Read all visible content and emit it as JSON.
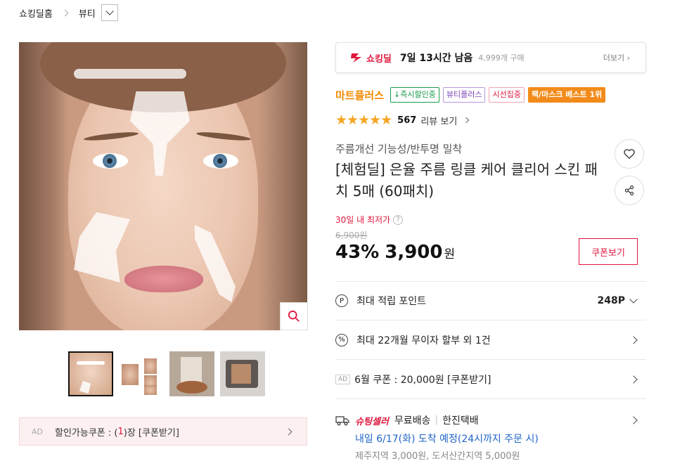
{
  "breadcrumb": {
    "home": "쇼킹딜홈",
    "category": "뷰티"
  },
  "coupon_bar": {
    "ad": "AD",
    "prefix": "할인가능쿠폰 : (",
    "count": "1",
    "suffix": ")장 [쿠폰받기]"
  },
  "deal": {
    "logo": "쇼킹딜",
    "time_left": "7일 13시간 남음",
    "sold": "4,999개 구매",
    "more": "더보기"
  },
  "brand": "마트플러스",
  "badges": [
    "↓즉시할인중",
    "뷰티플러스",
    "시선집중",
    "팩/마스크 베스트 1위"
  ],
  "rating": {
    "stars": "★★★★★",
    "count": "567",
    "review_label": "리뷰 보기"
  },
  "product": {
    "subtitle": "주름개선 기능성/반투명 밀착",
    "title": "[체험딜] 은율 주름 링클 케어 클리어 스킨 패치 5매 (60패치)"
  },
  "pricing": {
    "lowest_label": "30일 내 최저가",
    "help": "?",
    "original": "6,900원",
    "discount": "43%",
    "price": "3,900",
    "won": "원",
    "coupon_button": "쿠폰보기"
  },
  "rows": {
    "points_icon": "P",
    "points_label": "최대 적립 포인트",
    "points_value": "248P",
    "installment_icon": "%",
    "installment_label": "최대 22개월 무이자 할부 외 1건",
    "coupon_ad": "AD",
    "coupon_label": "6월 쿠폰 : 20,000원 [쿠폰받기]",
    "shipping_seller": "슈팅셀러",
    "shipping_free": "무료배송",
    "shipping_divider": "|",
    "shipping_carrier": "한진택배",
    "shipping_date": "내일 6/17(화) 도착 예정(24시까지 주문 시)",
    "shipping_extra": "제주지역 3,000원, 도서산간지역 5,000원"
  },
  "colors": {
    "accent": "#e0163d",
    "brand": "#f08a00",
    "star": "#f5a623",
    "delivery": "#1e64c8"
  }
}
